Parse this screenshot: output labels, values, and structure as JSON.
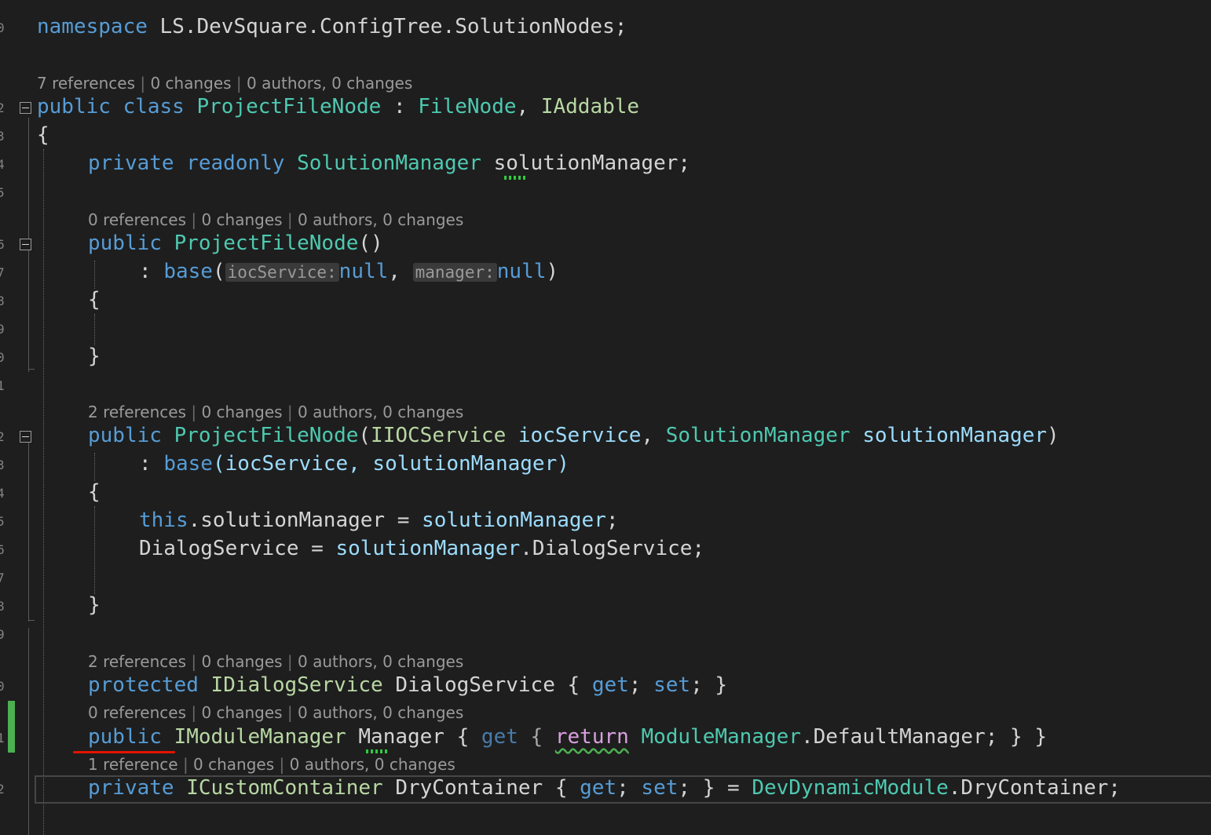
{
  "editor": {
    "namespace_line": [
      "namespace",
      " LS.DevSquare.ConfigTree.SolutionNodes;"
    ],
    "lens_class": {
      "refs": "7 references",
      "changes": "0 changes",
      "authors": "0 authors, 0 changes"
    },
    "class_decl": {
      "kw": "public class ",
      "name": "ProjectFileNode",
      "colon": " : ",
      "base": "FileNode",
      "comma": ", ",
      "iface": "IAddable"
    },
    "open_brace": "{",
    "close_brace": "}",
    "field_line": {
      "kw": "private readonly ",
      "type": "SolutionManager",
      "name": "solutionManager",
      "end": ";"
    },
    "lens_ctor1": {
      "refs": "0 references",
      "changes": "0 changes",
      "authors": "0 authors, 0 changes"
    },
    "ctor1_decl": {
      "kw": "public ",
      "name": "ProjectFileNode",
      "rest": "()"
    },
    "ctor1_base": {
      "pre": ": ",
      "kw": "base",
      "open": "(",
      "hint1": "iocService:",
      "val1": "null",
      "comma": ", ",
      "hint2": "manager:",
      "val2": "null",
      "close": ")"
    },
    "lens_ctor2": {
      "refs": "2 references",
      "changes": "0 changes",
      "authors": "0 authors, 0 changes"
    },
    "ctor2_decl": {
      "kw": "public ",
      "name": "ProjectFileNode",
      "open": "(",
      "t1": "IIOCService",
      "p1": " iocService",
      "comma": ", ",
      "t2": "SolutionManager",
      "p2": " solutionManager",
      "close": ")"
    },
    "ctor2_base": {
      "pre": ": ",
      "kw": "base",
      "args": "(iocService, solutionManager)"
    },
    "ctor2_body1": {
      "kw": "this",
      "rest": ".solutionManager = ",
      "val": "solutionManager",
      "end": ";"
    },
    "ctor2_body2": {
      "name": "DialogService = ",
      "val": "solutionManager",
      "rest": ".DialogService;"
    },
    "lens_prop1": {
      "refs": "2 references",
      "changes": "0 changes",
      "authors": "0 authors, 0 changes"
    },
    "prop1": {
      "kw": "protected ",
      "type": "IDialogService",
      "name": " DialogService { ",
      "get": "get",
      "mid": "; ",
      "set": "set",
      "end": "; }"
    },
    "lens_prop2": {
      "refs": "0 references",
      "changes": "0 changes",
      "authors": "0 authors, 0 changes"
    },
    "prop2": {
      "kw": "public",
      "sp": " ",
      "type": "IModuleManager",
      "name": " Manager { ",
      "get": "get",
      "mid": " { ",
      "ret": "return",
      "sp2": " ",
      "t2": "ModuleManager",
      "rest": ".DefaultManager; } }"
    },
    "lens_prop3": {
      "refs": "1 reference",
      "changes": "0 changes",
      "authors": "0 authors, 0 changes"
    },
    "prop3": {
      "kw": "private ",
      "type": "ICustomContainer",
      "name": " DryContainer { ",
      "get": "get",
      "mid": "; ",
      "set": "set",
      "mid2": "; } = ",
      "t2": "DevDynamicModule",
      "rest": ".DryContainer;"
    },
    "line_numbers": [
      "0",
      "2",
      "3",
      "4",
      "5",
      "6",
      "7",
      "8",
      "9",
      "0",
      "1",
      "2",
      "3",
      "4",
      "5",
      "6",
      "7",
      "8",
      "9",
      "0",
      "1",
      "2"
    ]
  }
}
